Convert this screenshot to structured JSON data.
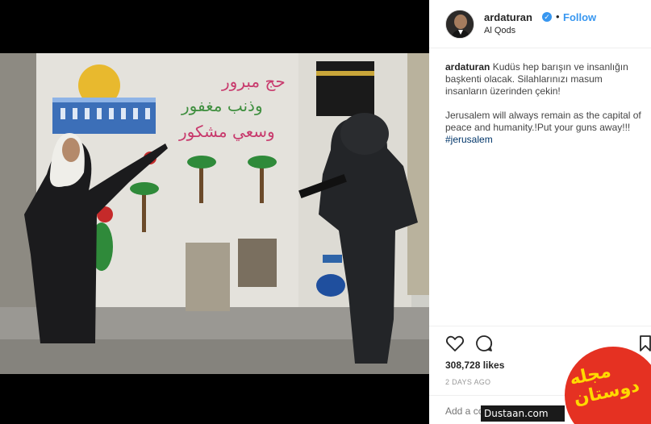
{
  "post": {
    "username": "ardaturan",
    "verified_icon": "verified-badge-icon",
    "follow_label": "Follow",
    "separator": "•",
    "location": "Al Qods"
  },
  "caption": {
    "username": "ardaturan",
    "text_tr": "Kudüs hep barışın ve insanlığın başkenti olacak. Silahlarınızı masum insanların üzerinden çekin!",
    "text_en": "Jerusalem will always remain as the capital of peace and humanity.!Put your guns away!!!",
    "hashtag": "#jerusalem"
  },
  "actions": {
    "like_icon": "heart-icon",
    "comment_icon": "comment-icon",
    "save_icon": "bookmark-icon"
  },
  "stats": {
    "likes": "308,728 likes",
    "time": "2 DAYS AGO"
  },
  "comment_box": {
    "placeholder": "Add a comment..."
  },
  "watermark": {
    "text": "مجله دوستان",
    "url": "Dustaan.com"
  },
  "photo": {
    "mural_text_1": "حج مبرور",
    "mural_text_2": "وذنب مغفور",
    "mural_text_3": "وسعي مشكور"
  },
  "colors": {
    "accent": "#3897f0",
    "watermark_red": "#e53122",
    "watermark_yellow": "#ffd900"
  }
}
